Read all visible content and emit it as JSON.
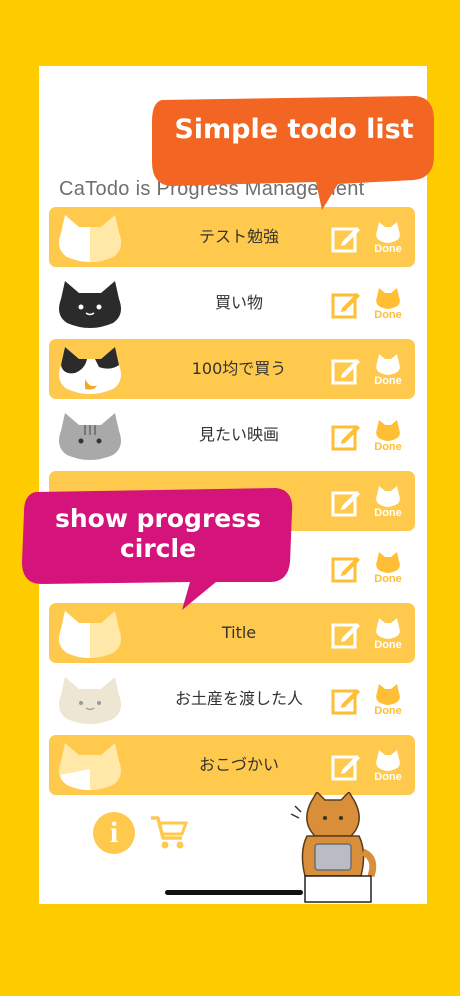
{
  "subtitle": "CaTodo is Progress Management",
  "callouts": {
    "top": "Simple todo list",
    "middle_line1": "show progress",
    "middle_line2": "circle"
  },
  "done_label": "Done",
  "todos": [
    {
      "title": "テスト勉強",
      "style": "yellow",
      "cat": "white-progress-cat"
    },
    {
      "title": "買い物",
      "style": "white",
      "cat": "black-cat"
    },
    {
      "title": "100均で買う",
      "style": "yellow",
      "cat": "calico-cat"
    },
    {
      "title": "見たい映画",
      "style": "white",
      "cat": "gray-tabby-cat"
    },
    {
      "title": "",
      "style": "yellow",
      "cat": "hidden"
    },
    {
      "title": "",
      "style": "white",
      "cat": "hidden"
    },
    {
      "title": "Title",
      "style": "yellow",
      "cat": "white-progress-cat"
    },
    {
      "title": "お土産を渡した人",
      "style": "white",
      "cat": "beige-cat"
    },
    {
      "title": "おこづかい",
      "style": "yellow",
      "cat": "white-progress-cat"
    }
  ],
  "colors": {
    "background": "#FFCC00",
    "row_yellow": "#FFC94D",
    "callout_orange": "#F26522",
    "callout_magenta": "#D4147B",
    "accent": "#FFBE33"
  }
}
